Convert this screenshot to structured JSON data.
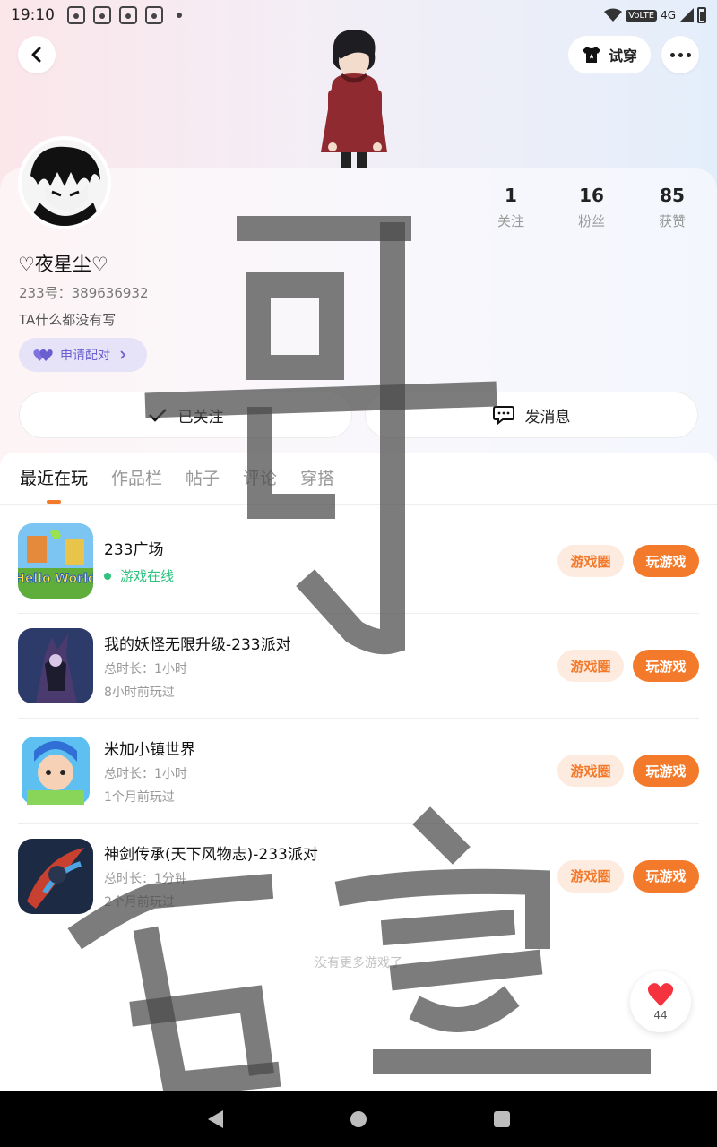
{
  "status_bar": {
    "time": "19:10",
    "network": "4G",
    "volte": "VoLTE"
  },
  "header": {
    "try_on_label": "试穿"
  },
  "profile": {
    "nickname": "♡夜星尘♡",
    "uid_text": "233号：389636932",
    "bio": "TA什么都没有写",
    "pair_label": "申请配对",
    "stats": [
      {
        "num": "1",
        "label": "关注"
      },
      {
        "num": "16",
        "label": "粉丝"
      },
      {
        "num": "85",
        "label": "获赞"
      }
    ],
    "followed_label": "已关注",
    "message_label": "发消息"
  },
  "tabs": [
    "最近在玩",
    "作品栏",
    "帖子",
    "评论",
    "穿搭"
  ],
  "games": [
    {
      "name": "233广场",
      "status": "游戏在线",
      "line1": "",
      "line2": ""
    },
    {
      "name": "我的妖怪无限升级-233派对",
      "line1": "总时长：1小时",
      "line2": "8小时前玩过"
    },
    {
      "name": "米加小镇世界",
      "line1": "总时长：1小时",
      "line2": "1个月前玩过"
    },
    {
      "name": "神剑传承(天下风物志)-233派对",
      "line1": "总时长：1分钟",
      "line2": "2个月前玩过"
    }
  ],
  "game_icon_labels": {
    "hello_world": "Hello World"
  },
  "buttons": {
    "circle": "游戏圈",
    "play": "玩游戏"
  },
  "no_more": "没有更多游戏了",
  "like_count": "44",
  "colors": {
    "accent": "#f47a2b",
    "online": "#2ec27e",
    "pair": "#6b5fd0"
  }
}
